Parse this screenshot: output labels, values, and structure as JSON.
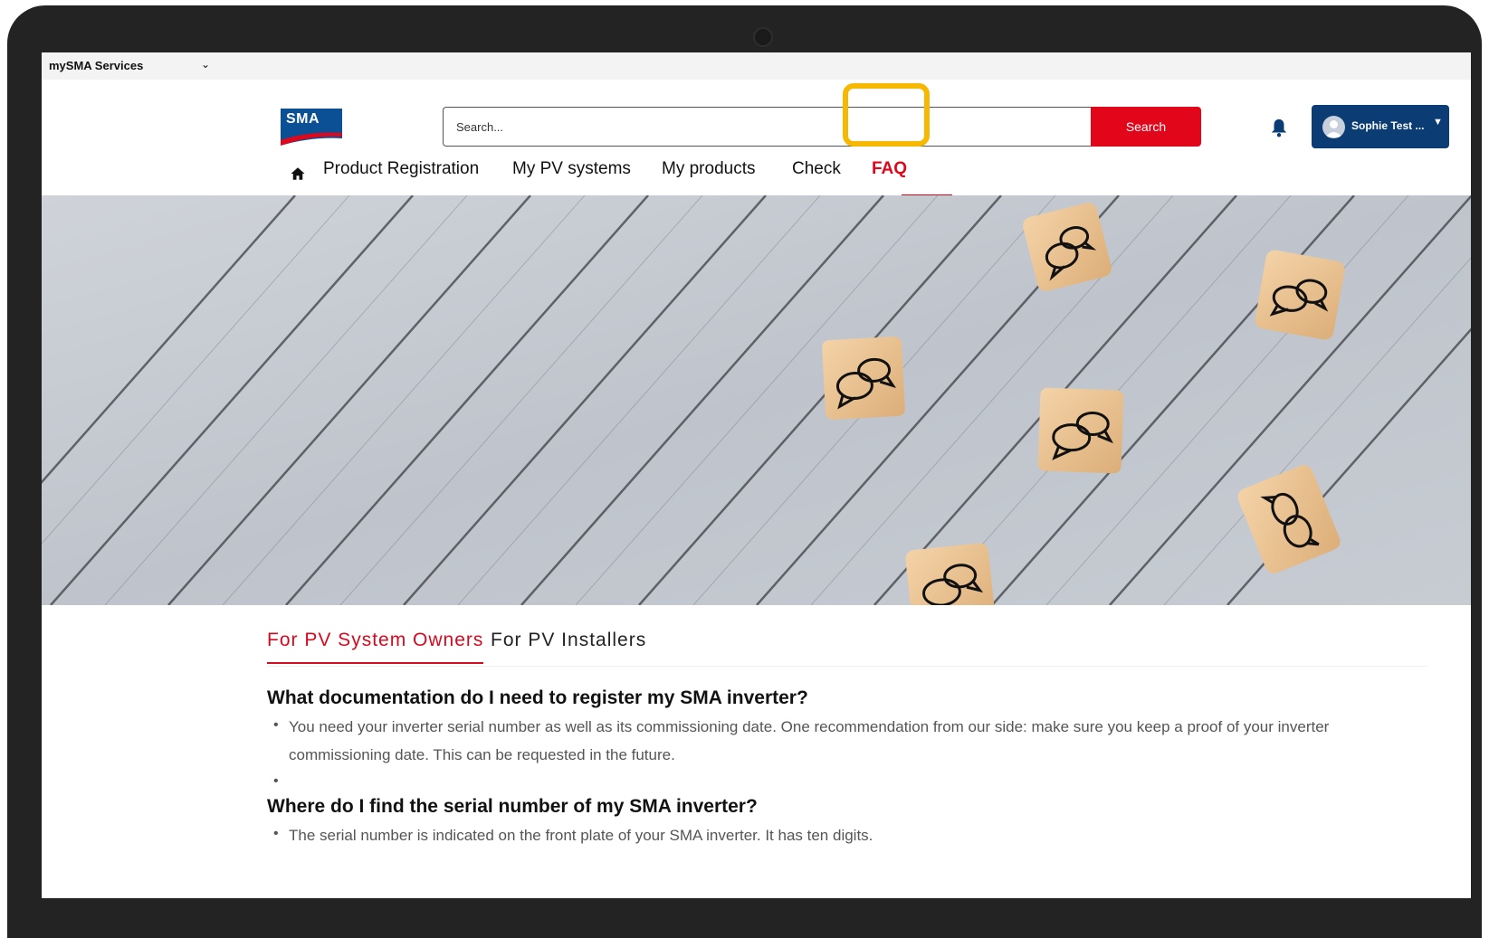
{
  "services_bar": {
    "label": "mySMA Services"
  },
  "header": {
    "logo_text": "SMA",
    "search": {
      "placeholder": "Search...",
      "button_label": "Search"
    },
    "user": {
      "name": "Sophie Test ..."
    }
  },
  "nav": {
    "items": [
      {
        "label": "Product Registration"
      },
      {
        "label": "My PV systems"
      },
      {
        "label": "My products"
      },
      {
        "label": "Check"
      },
      {
        "label": "FAQ"
      }
    ]
  },
  "tabs": [
    {
      "label": "For PV System Owners"
    },
    {
      "label": "For PV Installers"
    }
  ],
  "faq": [
    {
      "question": "What documentation do I need to register my SMA inverter?",
      "answer": "You need your inverter serial number as well as its commissioning date. One recommendation from our side: make sure you keep a proof of your inverter commissioning date. This can be requested in the future."
    },
    {
      "question": "Where do I find the serial number of my SMA inverter?",
      "answer": "The serial number is indicated on the front plate of your SMA inverter. It has ten digits."
    }
  ],
  "colors": {
    "brand_red": "#e2061b",
    "brand_blue": "#0b3c73",
    "highlight": "#f6b800"
  }
}
